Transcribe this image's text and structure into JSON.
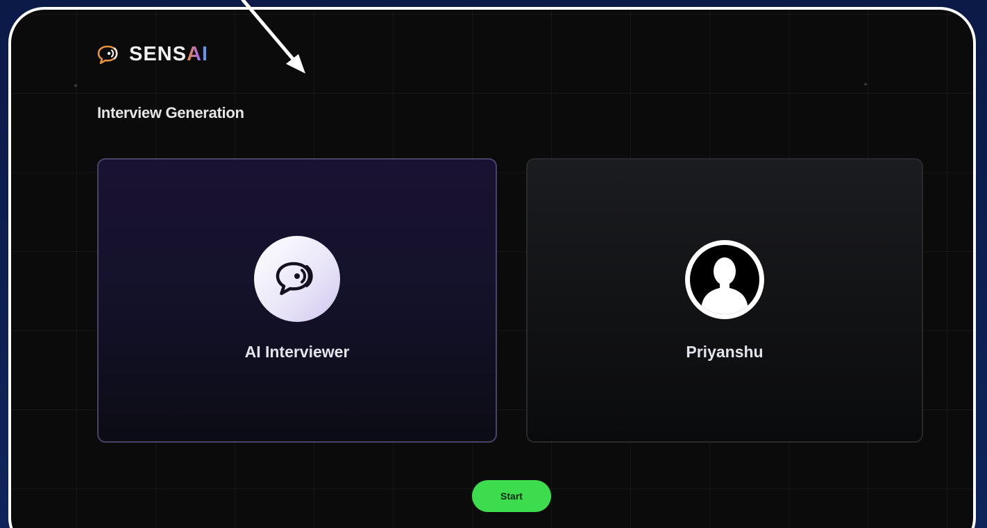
{
  "app": {
    "logo_text_main": "SENS",
    "logo_text_accent": "AI",
    "logo_icon": "speech-bubble-sound-icon"
  },
  "page": {
    "title": "Interview Generation"
  },
  "cards": {
    "ai": {
      "label": "AI Interviewer",
      "icon": "speech-bubble-sound-icon"
    },
    "user": {
      "label": "Priyanshu",
      "icon": "user-silhouette-icon"
    }
  },
  "actions": {
    "start_label": "Start"
  },
  "colors": {
    "background_outer": "#0d1d4f",
    "frame_border": "#ffffff",
    "surface": "#0b0b0c",
    "start_button": "#3ddc4e",
    "ai_card_border": "#4a4568"
  },
  "annotation": {
    "icon": "arrow-pointer-icon"
  }
}
